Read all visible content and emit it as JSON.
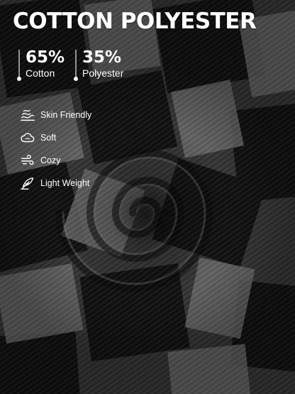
{
  "title": "COTTON POLYESTER",
  "composition": [
    {
      "percent": "65%",
      "material": "Cotton"
    },
    {
      "percent": "35%",
      "material": "Polyester"
    }
  ],
  "features": [
    {
      "label": "Skin Friendly",
      "icon": "skin-friendly-icon"
    },
    {
      "label": "Soft",
      "icon": "cloud-icon"
    },
    {
      "label": "Cozy",
      "icon": "wind-icon"
    },
    {
      "label": "Light Weight",
      "icon": "feather-icon"
    }
  ],
  "colors": {
    "fabric_dark": "#141414",
    "fabric_mid": "#3a3a3a",
    "fabric_light": "#6a6a6a",
    "text": "#ffffff"
  }
}
